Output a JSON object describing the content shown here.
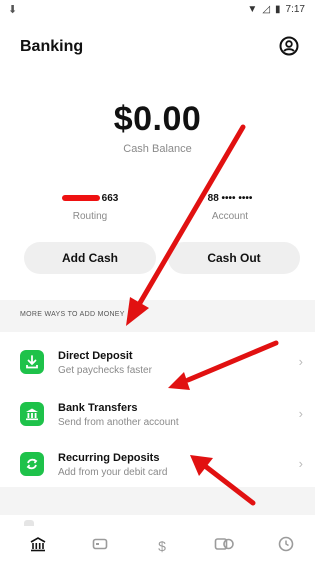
{
  "status_bar": {
    "time": "7:17"
  },
  "header": {
    "title": "Banking"
  },
  "balance": {
    "amount": "$0.00",
    "label": "Cash Balance"
  },
  "routing": {
    "number_suffix": "663",
    "label": "Routing"
  },
  "account": {
    "number": "88 •••• ••••",
    "label": "Account"
  },
  "buttons": {
    "add_cash": "Add Cash",
    "cash_out": "Cash Out"
  },
  "section": {
    "title": "MORE WAYS TO ADD MONEY"
  },
  "list": [
    {
      "title": "Direct Deposit",
      "subtitle": "Get paychecks faster",
      "icon": "download-icon"
    },
    {
      "title": "Bank Transfers",
      "subtitle": "Send from another account",
      "icon": "bank-icon"
    },
    {
      "title": "Recurring Deposits",
      "subtitle": "Add from your debit card",
      "icon": "recurring-icon"
    }
  ],
  "tabs": [
    {
      "icon": "bank-tab-icon",
      "active": true
    },
    {
      "icon": "card-tab-icon",
      "active": false
    },
    {
      "icon": "dollar-tab-icon",
      "active": false
    },
    {
      "icon": "activity-tab-icon",
      "active": false
    },
    {
      "icon": "clock-tab-icon",
      "active": false
    }
  ],
  "colors": {
    "accent_green": "#1ec24a",
    "annotation_red": "#e11111"
  }
}
